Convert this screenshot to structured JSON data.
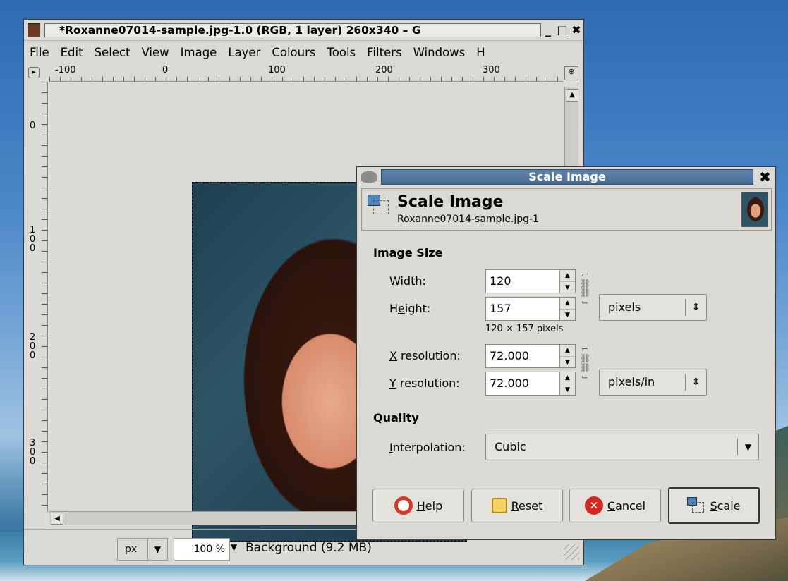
{
  "main_window": {
    "title": "*Roxanne07014-sample.jpg-1.0 (RGB, 1 layer) 260x340 – G",
    "controls": {
      "minimize": "_",
      "maximize": "□",
      "close": "✖"
    },
    "menu": [
      "File",
      "Edit",
      "Select",
      "View",
      "Image",
      "Layer",
      "Colours",
      "Tools",
      "Filters",
      "Windows",
      "H"
    ],
    "ruler_h_labels": [
      "-100",
      "0",
      "100",
      "200",
      "300"
    ],
    "ruler_v_labels": [
      "0",
      "1\n0\n0",
      "2\n0\n0",
      "3\n0\n0"
    ],
    "statusbar": {
      "unit": "px",
      "zoom": "100 %",
      "layer_info": "Background (9.2 MB)"
    }
  },
  "dialog": {
    "title": "Scale Image",
    "header_title": "Scale Image",
    "header_subtitle": "Roxanne07014-sample.jpg-1",
    "image_size": {
      "section": "Image Size",
      "width_label_pre": "",
      "width_label_u": "W",
      "width_label_post": "idth:",
      "width_value": "120",
      "height_label_pre": "H",
      "height_label_u": "e",
      "height_label_post": "ight:",
      "height_value": "157",
      "size_unit": "pixels",
      "size_hint": "120 × 157 pixels",
      "xres_label_u": "X",
      "xres_label_post": " resolution:",
      "xres_value": "72.000",
      "yres_label_u": "Y",
      "yres_label_post": " resolution:",
      "yres_value": "72.000",
      "res_unit": "pixels/in"
    },
    "quality": {
      "section": "Quality",
      "interp_label_u": "I",
      "interp_label_post": "nterpolation:",
      "interp_value": "Cubic"
    },
    "buttons": {
      "help_u": "H",
      "help_post": "elp",
      "reset_u": "R",
      "reset_post": "eset",
      "cancel_u": "C",
      "cancel_post": "ancel",
      "scale_u": "S",
      "scale_post": "cale"
    }
  }
}
